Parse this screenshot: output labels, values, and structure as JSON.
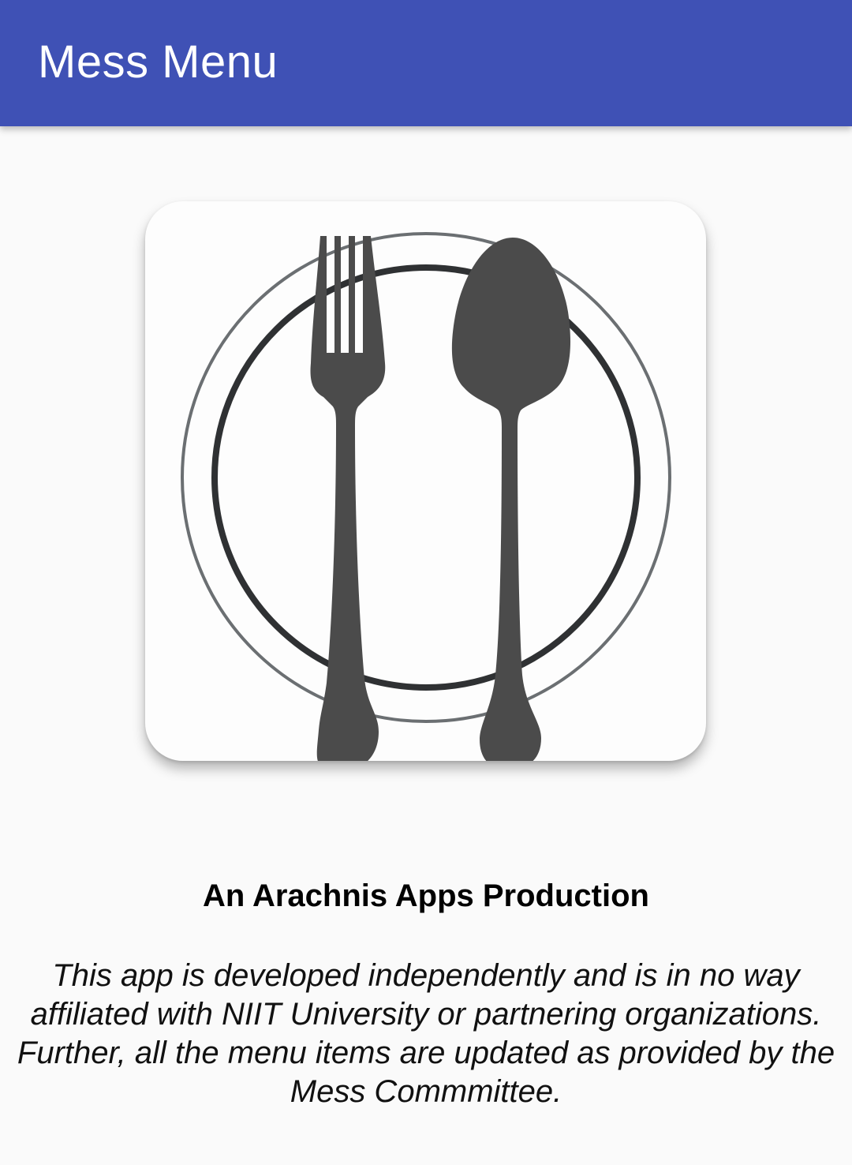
{
  "app_bar": {
    "title": "Mess Menu",
    "background_color": "#3f51b5"
  },
  "logo": {
    "icon": "plate-fork-spoon-icon"
  },
  "about": {
    "credit": "An Arachnis Apps Production",
    "disclaimer": "This app is developed independently and is in no way affiliated with NIIT University or partnering organizations. Further, all the menu items are updated as provided by the Mess Commmittee."
  }
}
